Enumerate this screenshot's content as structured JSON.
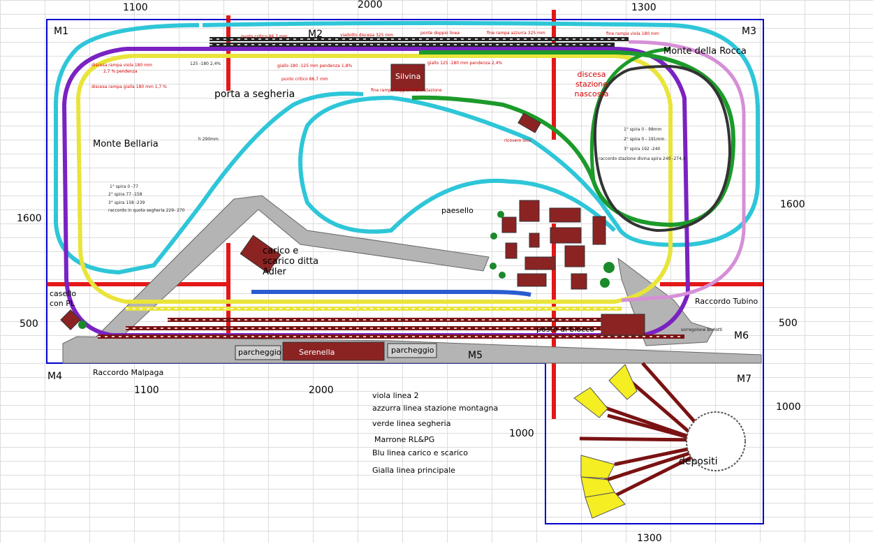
{
  "dimensions": {
    "top_1100": "1100",
    "top_2000": "2000",
    "top_1300": "1300",
    "left_1600": "1600",
    "left_500": "500",
    "right_1600": "1600",
    "right_500": "500",
    "right_1000": "1000",
    "bottom_1100": "1100",
    "bottom_2000": "2000",
    "mid_1000": "1000",
    "bottom_1300": "1300"
  },
  "modules": [
    "M1",
    "M2",
    "M3",
    "M4",
    "M5",
    "M6",
    "M7"
  ],
  "places": {
    "monte_della_rocca": "Monte della Rocca",
    "monte_bellaria": "Monte Bellaria",
    "porta_segheria": "porta a segheria",
    "silvina": "Silvina",
    "discesa": "discesa stazione nascosta",
    "paesello": "paesello",
    "carico": "carico e scarico ditta Adler",
    "casello": "casello con PL",
    "raccordo_tubino": "Raccordo Tubino",
    "posto_blocco": "posto di blocco",
    "parcheggio_left": "parcheggio",
    "serenella": "Serenella",
    "parcheggio_right": "parcheggio",
    "raccordo_malpaga": "Raccordo Malpaga",
    "depositi": "depositi",
    "h290": "h 290mm",
    "ricovero": "ricovero loco"
  },
  "notes": {
    "spira_right_1": "1° spira 0 - 98mm",
    "spira_right_2": "2° spira 0 - 191mm",
    "spira_right_3": "3° spira 192 -240",
    "raccordo_stazione": "raccordo stazione divina spira 240 -274,4",
    "spira_left_1": "1° spira 0 -77",
    "spira_left_2": "2° spira 77 -158",
    "spira_left_3": "3° spira 158 -239",
    "raccordo_quota": "raccordo in quota  segheria 229- 270",
    "n125": "125 -180 2,4%",
    "note_sborgo": "sorregolone Borlotti"
  },
  "red_notes": {
    "punto_critico_top": "punto critico 86,7 mm",
    "viadotto": "viadotto discesa 325 mm",
    "ponte": "ponte doppio linea",
    "fine_azzurra": "fine rampa azzurra 325 mm",
    "fine_viola_right": "fine rampa viola 180 mm",
    "discesa_viola": "discesa rampa viola 180 mm",
    "pendenza": "2,7 % pendenza",
    "discesa_gialla": "discesa rampa gialla 180 mm 1,7 %",
    "giallo_180": "giallo 180 -125 mm pendenza 1,8%",
    "giallo_125": "giallo 125 -180 mm pendenza 2,4%",
    "punto_critico_mid": "punto critico 86,7 mm",
    "fine_rampa_livello": "fine rampa doppia livello stazione"
  },
  "legend": [
    "viola linea 2",
    "azzurra linea stazione montagna",
    "verde linea segheria",
    "Marrone RL&PG",
    "Blu linea carico e scarico",
    "Gialla linea principale"
  ],
  "colors": {
    "viola": "#7a22c2",
    "azzurra": "#2ec6d8",
    "verde": "#1c9a2a",
    "marrone": "#7a1212",
    "blu": "#2a5cd0",
    "gialla": "#e9e43a",
    "rosa": "#d68fd6",
    "grigio": "#8a8a8a",
    "nero": "#222222",
    "frame": "#0000cc",
    "axis": "#e00000"
  }
}
